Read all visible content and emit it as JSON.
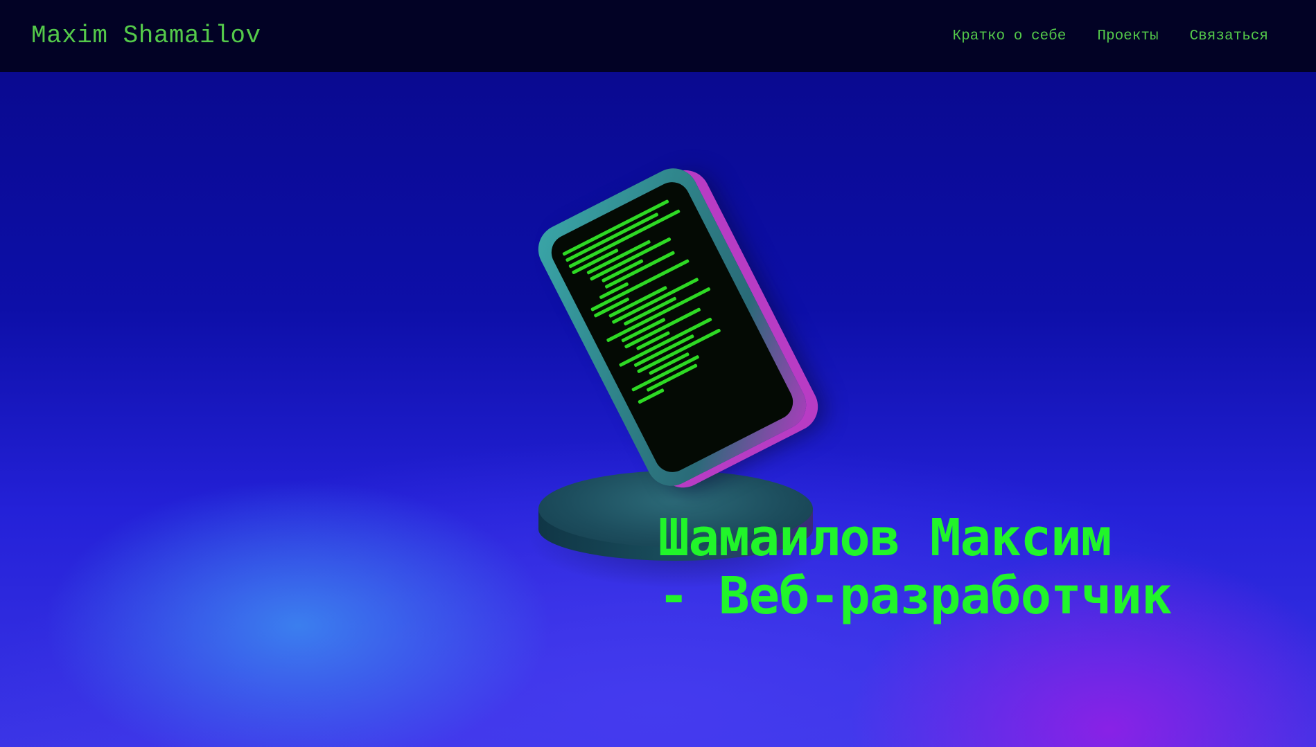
{
  "header": {
    "brand": "Maxim Shamailov",
    "nav": [
      {
        "label": "Кратко о себе"
      },
      {
        "label": "Проекты"
      },
      {
        "label": "Связаться"
      }
    ]
  },
  "hero": {
    "headline_line1": "Шамаилов Максим",
    "headline_line2": "- Веб-разработчик",
    "illustration_icon": "phone-with-code-on-pedestal-icon"
  },
  "colors": {
    "accent_green": "#21f52a",
    "nav_green": "#54c94a",
    "header_bg": "#020225",
    "hero_blue": "#1b1bc8",
    "hero_purple": "#8a1de0"
  }
}
